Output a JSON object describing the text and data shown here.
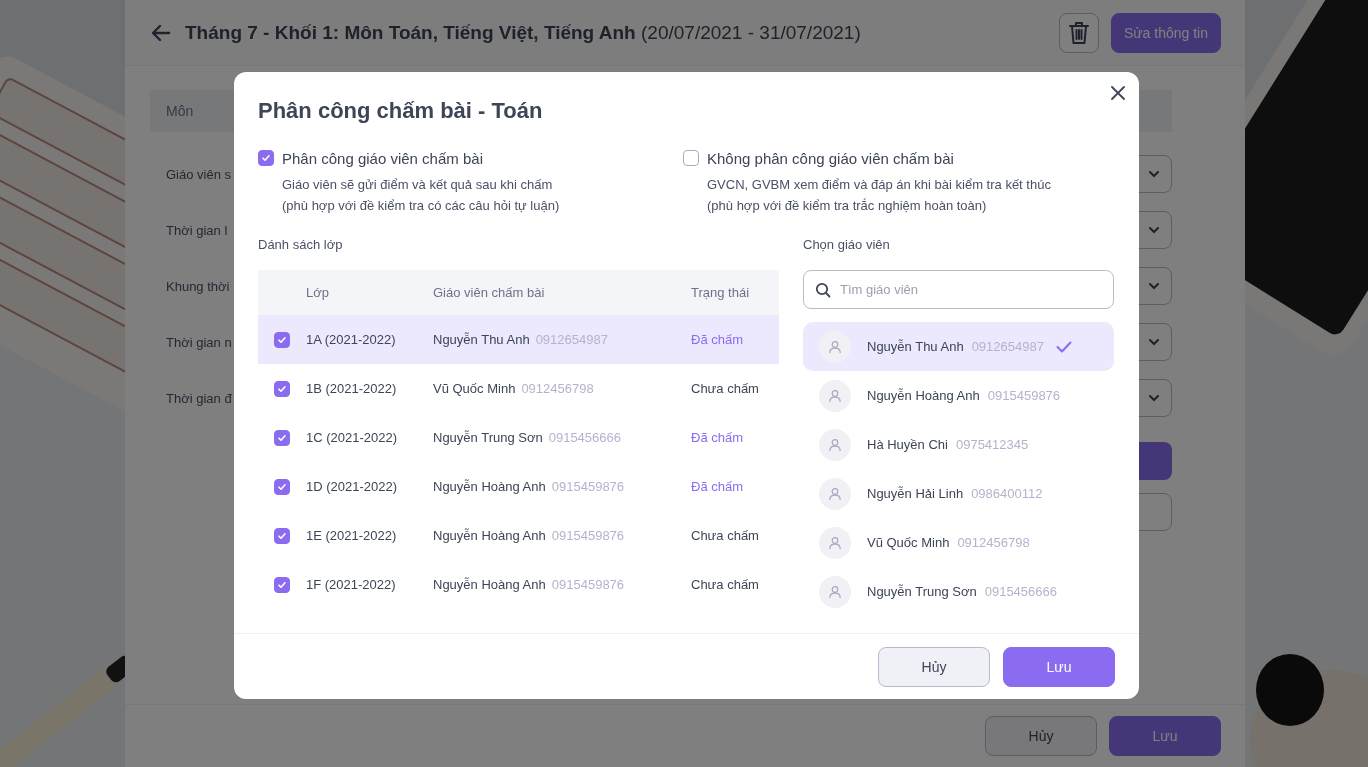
{
  "page": {
    "title": "Tháng 7 - Khối 1: Môn Toán, Tiếng Việt, Tiếng Anh",
    "date_range": "(20/07/2021 - 31/07/2021)",
    "edit_button": "Sửa thông tin",
    "table_header": "Môn",
    "form_labels": [
      "Giáo viên s",
      "Thời gian l",
      "Khung thời",
      "Thời gian n",
      "Thời gian đ"
    ],
    "buttons": [
      {
        "label": "Hủy",
        "kind": "secondary"
      },
      {
        "label": "Lưu",
        "kind": "primary"
      }
    ]
  },
  "dialog": {
    "title": "Phân công chấm bài - Toán",
    "options": [
      {
        "label": "Phân công giáo viên chấm bài",
        "checked": true,
        "description": [
          "Giáo viên sẽ gửi điểm và kết quả sau khi chấm",
          "(phù hợp với đề kiểm tra có các câu hỏi tự luận)"
        ]
      },
      {
        "label": "Không phân công giáo viên chấm bài",
        "checked": false,
        "description": [
          "GVCN, GVBM xem điểm và đáp án khi bài kiểm tra kết thúc",
          "(phù hợp với đề kiểm tra trắc nghiệm hoàn toàn)"
        ]
      }
    ],
    "class_list": {
      "heading": "Dánh sách lớp",
      "columns": [
        "Lớp",
        "Giáo viên chấm bài",
        "Trạng thái"
      ],
      "rows": [
        {
          "class": "1A (2021-2022)",
          "teacher": "Nguyễn Thu Anh",
          "phone": "0912654987",
          "status": "Đã chấm",
          "graded": true,
          "checked": true,
          "selected": true
        },
        {
          "class": "1B (2021-2022)",
          "teacher": "Vũ Quốc Minh",
          "phone": "0912456798",
          "status": "Chưa chấm",
          "graded": false,
          "checked": true,
          "selected": false
        },
        {
          "class": "1C (2021-2022)",
          "teacher": "Nguyễn Trung Sơn",
          "phone": "0915456666",
          "status": "Đã chấm",
          "graded": true,
          "checked": true,
          "selected": false
        },
        {
          "class": "1D (2021-2022)",
          "teacher": "Nguyễn Hoàng Anh",
          "phone": "0915459876",
          "status": "Đã chấm",
          "graded": true,
          "checked": true,
          "selected": false
        },
        {
          "class": "1E (2021-2022)",
          "teacher": "Nguyễn Hoàng Anh",
          "phone": "0915459876",
          "status": "Chưa chấm",
          "graded": false,
          "checked": true,
          "selected": false
        },
        {
          "class": "1F (2021-2022)",
          "teacher": "Nguyễn Hoàng Anh",
          "phone": "0915459876",
          "status": "Chưa chấm",
          "graded": false,
          "checked": true,
          "selected": false
        }
      ]
    },
    "teacher_picker": {
      "heading": "Chọn giáo viên",
      "search": {
        "placeholder": "Tìm giáo viên"
      },
      "teachers": [
        {
          "name": "Nguyễn Thu Anh",
          "phone": "0912654987",
          "selected": true
        },
        {
          "name": "Nguyễn Hoàng Anh",
          "phone": "0915459876",
          "selected": false
        },
        {
          "name": "Hà Huyền Chi",
          "phone": "0975412345",
          "selected": false
        },
        {
          "name": "Nguyễn Hải Linh",
          "phone": "0986400112",
          "selected": false
        },
        {
          "name": "Vũ Quốc Minh",
          "phone": "0912456798",
          "selected": false
        },
        {
          "name": "Nguyễn Trung Sơn",
          "phone": "0915456666",
          "selected": false
        }
      ]
    },
    "buttons": [
      {
        "label": "Hủy",
        "kind": "secondary"
      },
      {
        "label": "Lưu",
        "kind": "primary"
      }
    ]
  }
}
